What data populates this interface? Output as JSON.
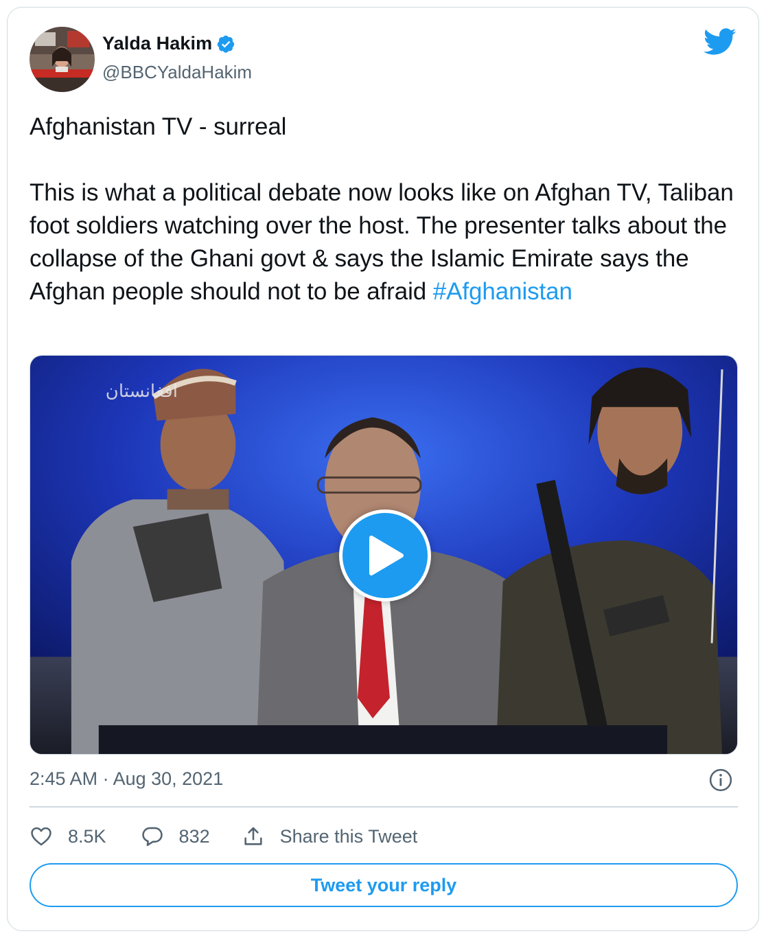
{
  "author": {
    "display_name": "Yalda Hakim",
    "handle": "@BBCYaldaHakim",
    "verified": true
  },
  "tweet": {
    "line1": "Afghanistan TV - surreal",
    "body": "This is what a political debate now looks like on Afghan TV, Taliban foot soldiers watching over the host. The presenter talks about the collapse of the Ghani govt & says the Islamic Emirate says the Afghan people should not to be afraid",
    "hashtag": "#Afghanistan",
    "timestamp": "2:45 AM · Aug 30, 2021"
  },
  "media": {
    "type": "video",
    "channel_logo_text": "افغانستان"
  },
  "actions": {
    "likes": "8.5K",
    "replies": "832",
    "share_label": "Share this Tweet"
  },
  "reply_button_label": "Tweet your reply",
  "colors": {
    "accent": "#1d9bf0",
    "text_primary": "#0f1419",
    "text_secondary": "#536471",
    "border": "#cfd9de"
  },
  "icons": [
    "verified-badge-icon",
    "twitter-bird-icon",
    "play-icon",
    "info-icon",
    "heart-icon",
    "reply-bubble-icon",
    "share-icon"
  ]
}
